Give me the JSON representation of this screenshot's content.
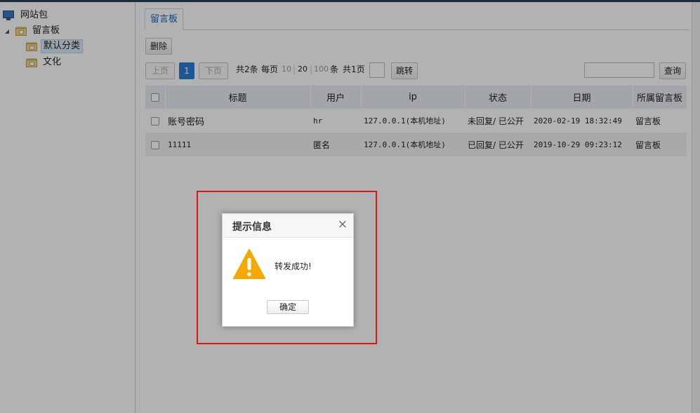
{
  "tree": {
    "root": "网站包",
    "board": "留言板",
    "children": [
      "默认分类",
      "文化"
    ]
  },
  "tab": {
    "label": "留言板"
  },
  "toolbar": {
    "delete": "删除"
  },
  "pager": {
    "prev": "上页",
    "current": "1",
    "next": "下页",
    "total": "共2条",
    "per_page": "每页",
    "size_10": "10",
    "sep": "|",
    "size_20": "20",
    "size_100": "100",
    "unit": "条",
    "pages": "共1页",
    "jump": "跳转"
  },
  "search": {
    "button": "查询",
    "value": ""
  },
  "table": {
    "headers": [
      "标题",
      "用户",
      "ip",
      "状态",
      "日期",
      "所属留言板"
    ],
    "rows": [
      {
        "title": "账号密码",
        "user": "hr",
        "ip": "127.0.0.1(本机地址)",
        "status": "未回复/ 已公开",
        "date": "2020-02-19 18:32:49",
        "board": "留言板"
      },
      {
        "title": "11111",
        "user": "匿名",
        "ip": "127.0.0.1(本机地址)",
        "status": "已回复/ 已公开",
        "date": "2019-10-29 09:23:12",
        "board": "留言板"
      }
    ]
  },
  "dialog": {
    "title": "提示信息",
    "close": "×",
    "message": "转发成功!",
    "ok": "确定",
    "icon": "warning-icon"
  },
  "colors": {
    "accent": "#2a7fd4",
    "highlight": "#e01414",
    "warning": "#f5a800"
  }
}
